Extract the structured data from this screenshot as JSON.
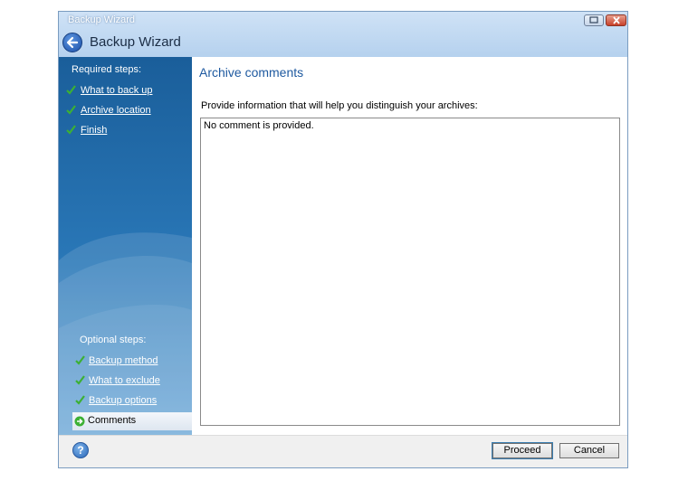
{
  "window": {
    "titlebar_text": "Backup Wizard",
    "wizard_title": "Backup Wizard"
  },
  "sidebar": {
    "required_heading": "Required steps:",
    "required_items": [
      {
        "label": "What to back up",
        "completed": true
      },
      {
        "label": "Archive location",
        "completed": true
      },
      {
        "label": "Finish",
        "completed": true
      }
    ],
    "optional_heading": "Optional steps:",
    "optional_items": [
      {
        "label": "Backup method",
        "completed": true
      },
      {
        "label": "What to exclude",
        "completed": true
      },
      {
        "label": "Backup options",
        "completed": true
      }
    ],
    "current_step": "Comments"
  },
  "main": {
    "title": "Archive comments",
    "description": "Provide information that will help you distinguish your archives:",
    "comment_value": "No comment is provided."
  },
  "footer": {
    "proceed_label": "Proceed",
    "cancel_label": "Cancel"
  },
  "colors": {
    "sidebar_top": "#1a5e9a",
    "sidebar_bottom": "#5fa0d4",
    "title_accent": "#1f5aa0",
    "check_green": "#3cb034"
  }
}
